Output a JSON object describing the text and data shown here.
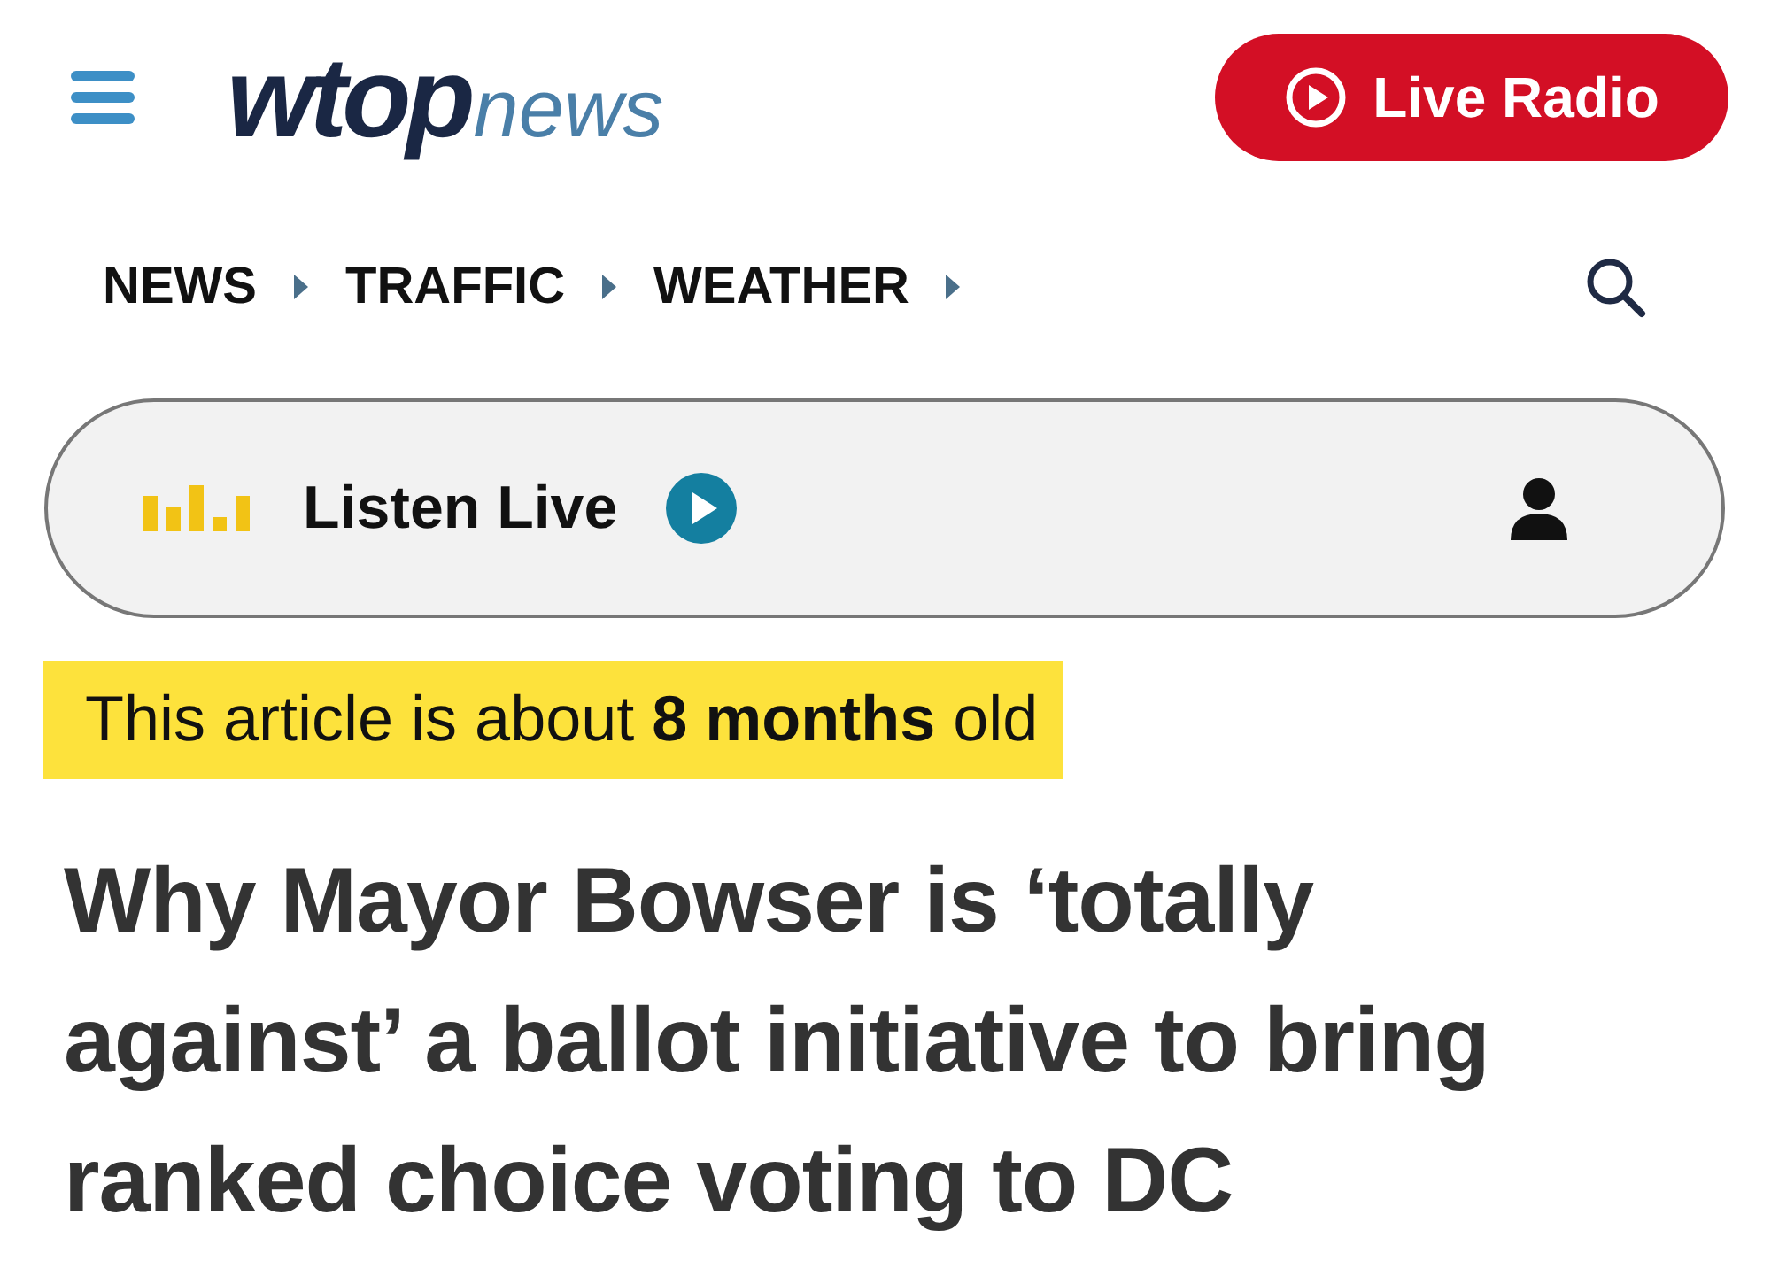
{
  "header": {
    "logo_main": "wtop",
    "logo_sub": "news",
    "live_button": "Live Radio"
  },
  "nav": {
    "items": [
      {
        "label": "NEWS"
      },
      {
        "label": "TRAFFIC"
      },
      {
        "label": "WEATHER"
      }
    ]
  },
  "listen_bar": {
    "label": "Listen Live"
  },
  "notice": "This article is about **8 months** old",
  "headline": "Why Mayor Bowser is ‘totally against’ a ballot initiative to bring ranked choice voting to DC"
}
